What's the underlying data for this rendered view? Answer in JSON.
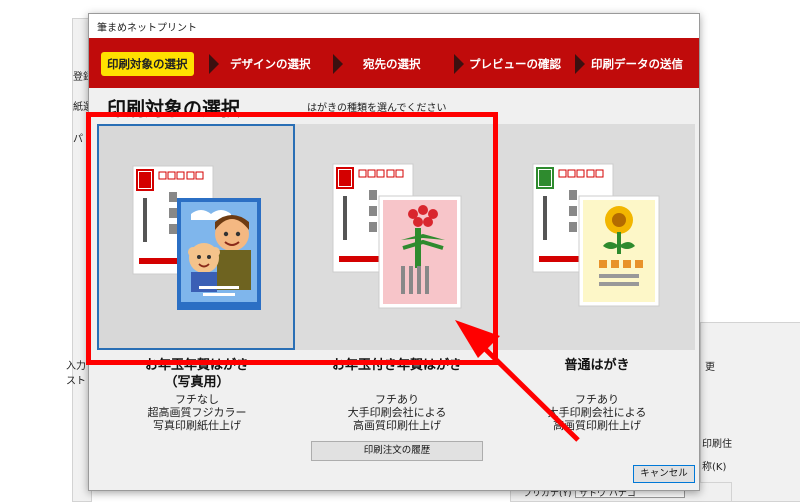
{
  "window": {
    "title": "筆まめネットプリント"
  },
  "steps": [
    {
      "label": "印刷対象の選択",
      "active": true
    },
    {
      "label": "デザインの選択",
      "active": false
    },
    {
      "label": "宛先の選択",
      "active": false
    },
    {
      "label": "プレビューの確認",
      "active": false
    },
    {
      "label": "印刷データの送信",
      "active": false
    }
  ],
  "page": {
    "heading": "印刷対象の選択",
    "hint": "はがきの種類を選んでください"
  },
  "cards": [
    {
      "title": "お年玉年賀はがき",
      "subtitle": "（写真用）",
      "desc": [
        "フチなし",
        "超高画質フジカラー",
        "写真印刷紙仕上げ"
      ],
      "selected": true
    },
    {
      "title": "お年玉付き年賀はがき",
      "subtitle": "",
      "desc": [
        "フチあり",
        "大手印刷会社による",
        "高画質印刷仕上げ"
      ],
      "selected": false
    },
    {
      "title": "普通はがき",
      "subtitle": "",
      "desc": [
        "フチあり",
        "大手印刷会社による",
        "高画質印刷仕上げ"
      ],
      "selected": false
    }
  ],
  "buttons": {
    "history": "印刷注文の履歴",
    "cancel": "キャンセル"
  },
  "background": {
    "register": "登録",
    "paper": "紙選",
    "pa": "パ",
    "input": "入力",
    "list": "スト",
    "print_label": "印刷住",
    "furigana_label": "フリガナ(Y)",
    "furigana_value": "サトウ ハナコ",
    "k_label": "称(K)",
    "more": "更",
    "rest": "入力"
  },
  "colors": {
    "step_bar": "#c00b0b",
    "active_step": "#ffe000",
    "annotation": "#ff0000",
    "selection": "#2a6fb5"
  }
}
